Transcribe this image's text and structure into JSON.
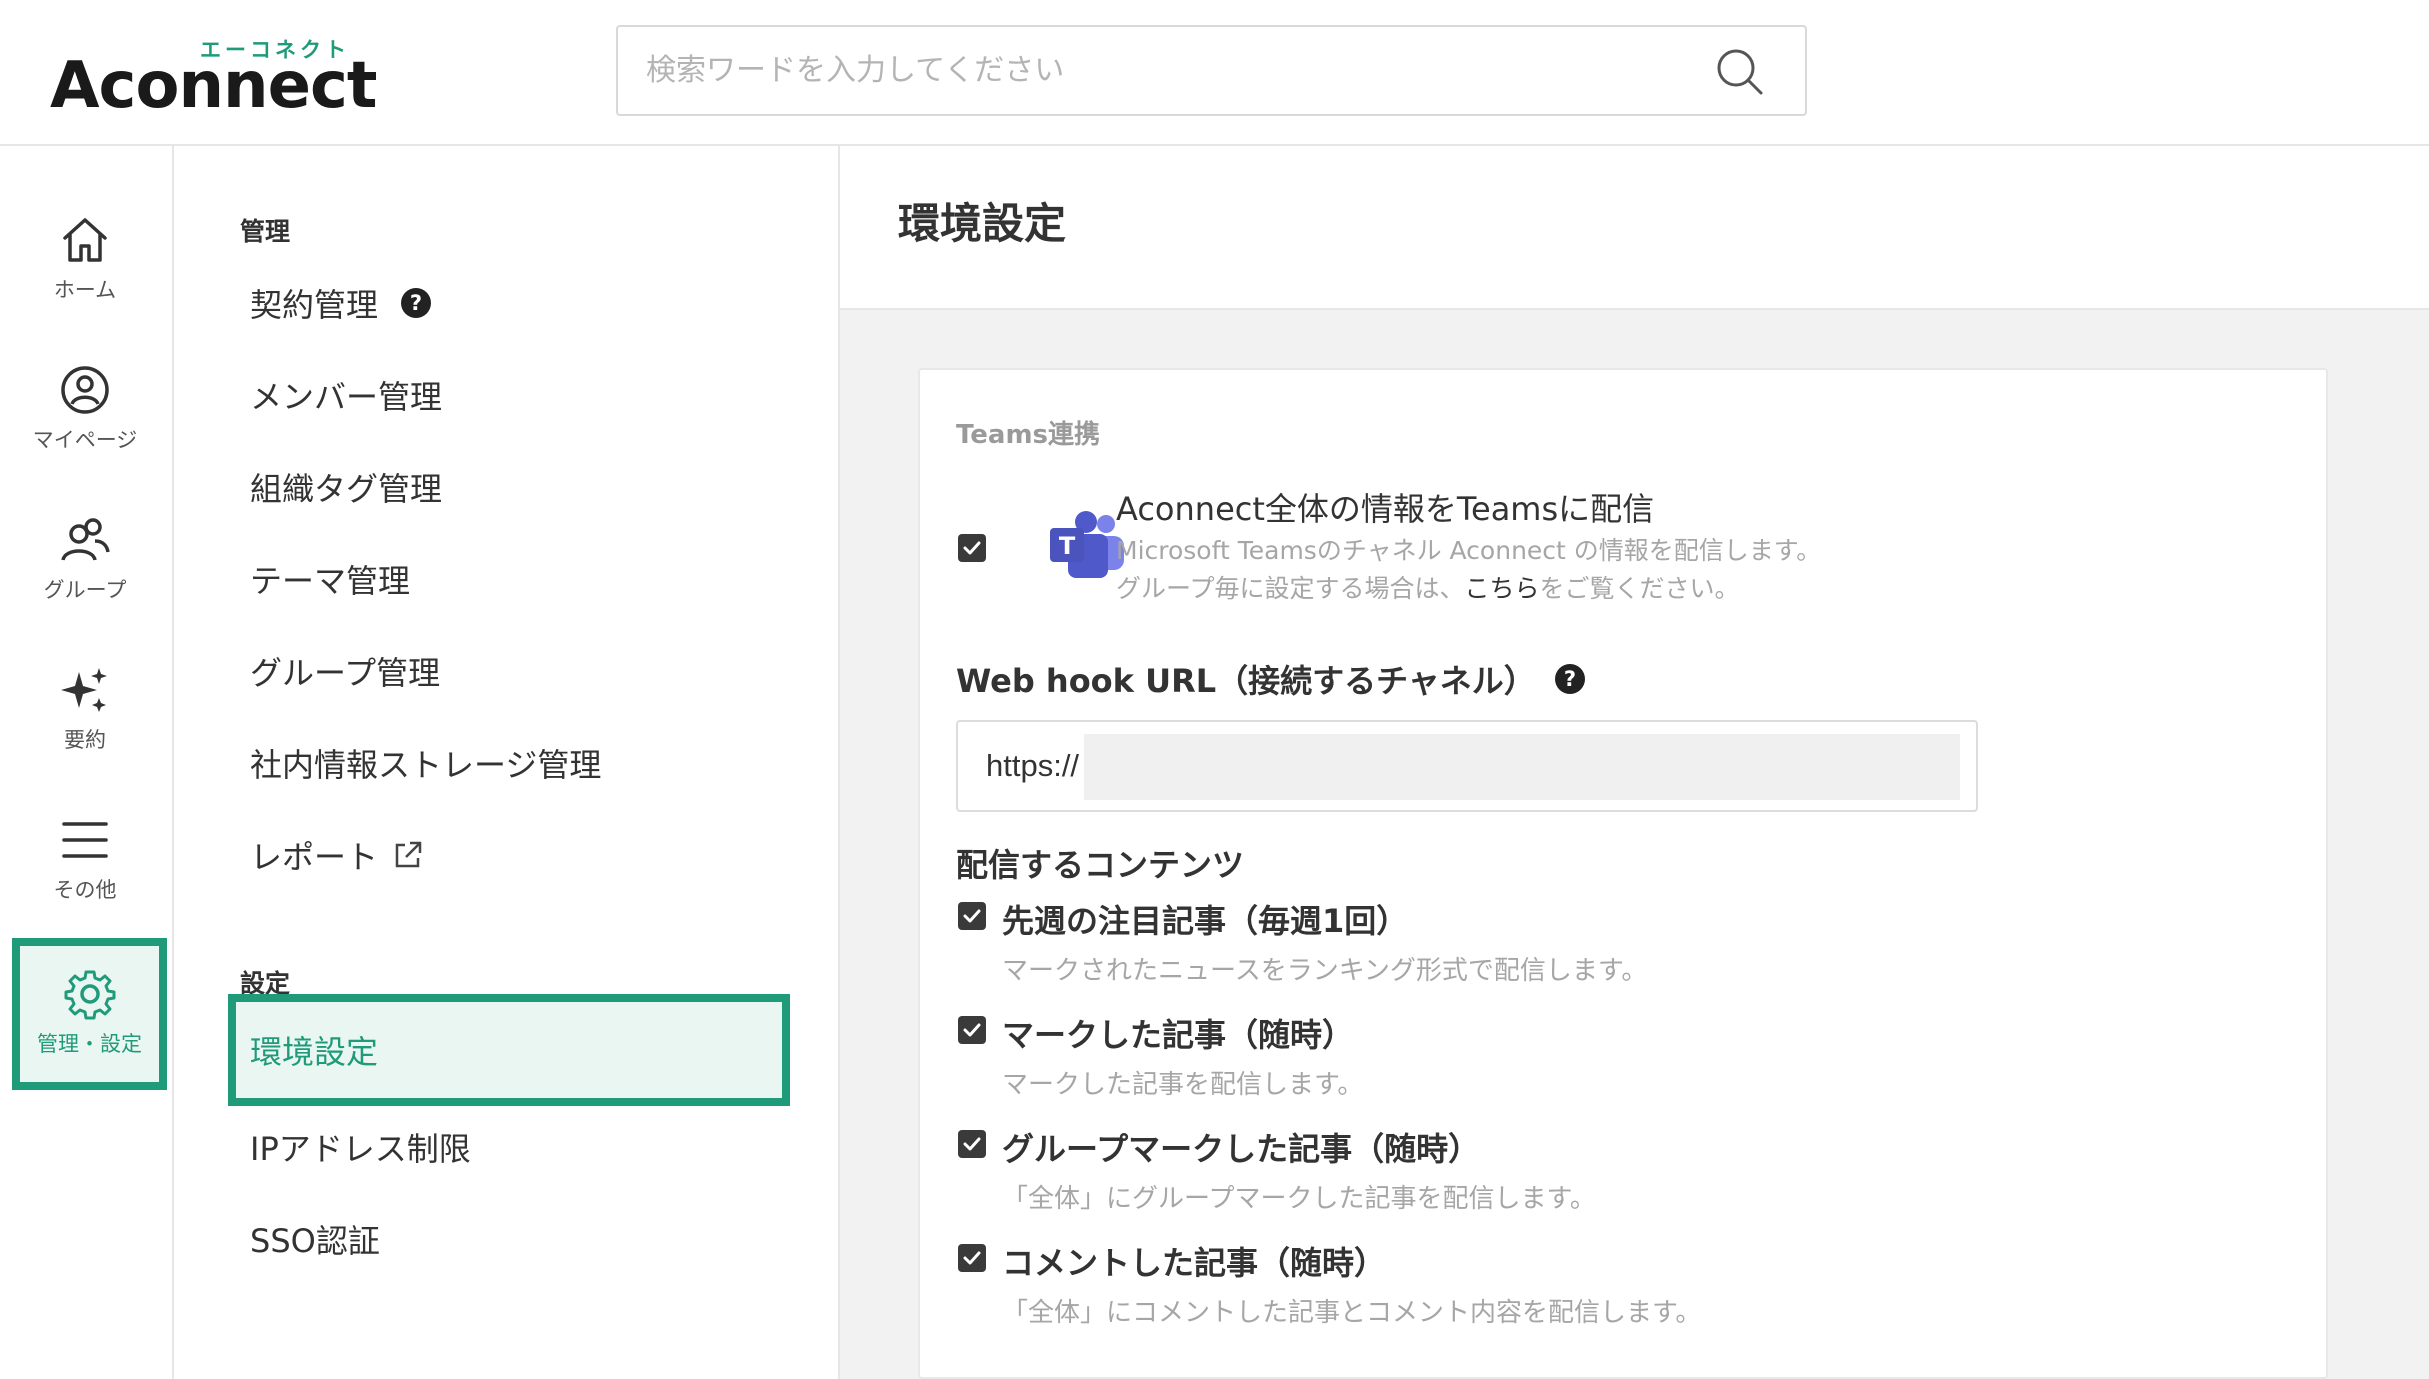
{
  "header": {
    "logo_kana": "エーコネクト",
    "logo_text": "Aconnect",
    "search_placeholder": "検索ワードを入力してください"
  },
  "rail": {
    "items": [
      {
        "label": "ホーム",
        "icon": "home-icon"
      },
      {
        "label": "マイページ",
        "icon": "user-circle-icon"
      },
      {
        "label": "グループ",
        "icon": "group-icon"
      },
      {
        "label": "要約",
        "icon": "sparkle-icon"
      },
      {
        "label": "その他",
        "icon": "menu-icon"
      },
      {
        "label": "管理・設定",
        "icon": "gear-icon",
        "active": true
      }
    ]
  },
  "submenu": {
    "management_label": "管理",
    "management_items": [
      "契約管理",
      "メンバー管理",
      "組織タグ管理",
      "テーマ管理",
      "グループ管理",
      "社内情報ストレージ管理",
      "レポート"
    ],
    "settings_label": "設定",
    "settings_items": [
      "環境設定",
      "IPアドレス制限",
      "SSO認証"
    ],
    "active_item": "環境設定"
  },
  "main": {
    "page_title": "環境設定",
    "section_title": "Teams連携",
    "teams": {
      "title": "Aconnect全体の情報をTeamsに配信",
      "desc_line1": "Microsoft Teamsのチャネル Aconnect の情報を配信します。",
      "desc_line2_pre": "グループ毎に設定する場合は、",
      "desc_line2_link": "こちら",
      "desc_line2_post": "をご覧ください。",
      "checked": true
    },
    "webhook_label": "Web hook URL（接続するチャネル）",
    "webhook_value": "https://",
    "contents_label": "配信するコンテンツ",
    "options": [
      {
        "title": "先週の注目記事（毎週1回）",
        "desc": "マークされたニュースをランキング形式で配信します。",
        "checked": true
      },
      {
        "title": "マークした記事（随時）",
        "desc": "マークした記事を配信します。",
        "checked": true
      },
      {
        "title": "グループマークした記事（随時）",
        "desc": "「全体」にグループマークした記事を配信します。",
        "checked": true
      },
      {
        "title": "コメントした記事（随時）",
        "desc": "「全体」にコメントした記事とコメント内容を配信します。",
        "checked": true
      }
    ]
  },
  "colors": {
    "accent": "#1f9b7a",
    "accent_bg": "#eaf6f1",
    "teams_purple": "#5059c9"
  }
}
